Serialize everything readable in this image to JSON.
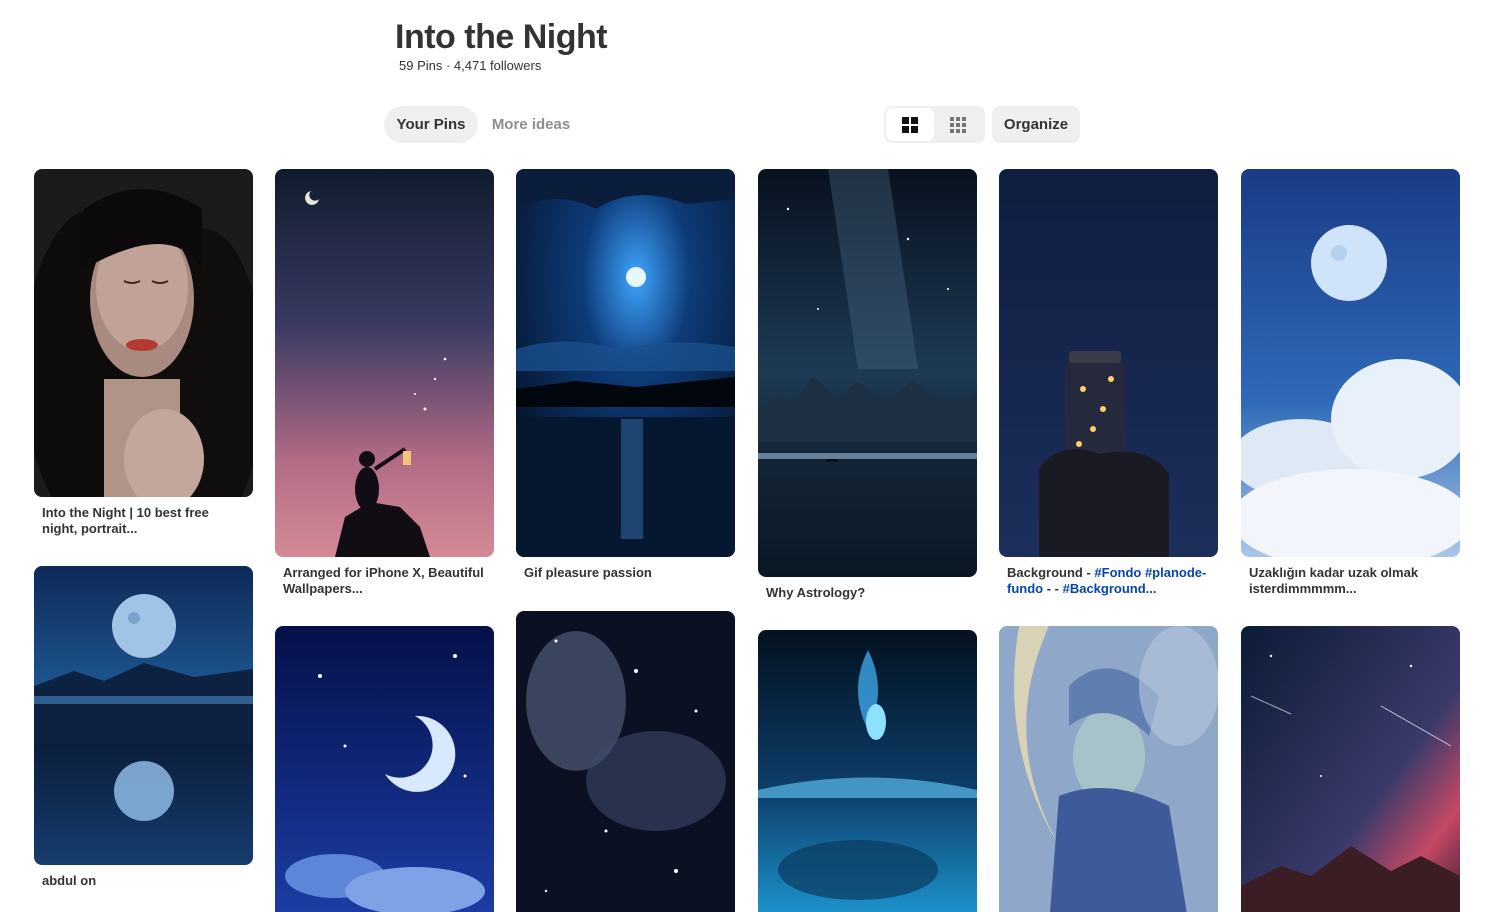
{
  "board": {
    "title": "Into the Night",
    "meta": "59 Pins · 4,471 followers"
  },
  "tabs": {
    "your_pins": "Your Pins",
    "more_ideas": "More ideas"
  },
  "toolbar": {
    "organize_label": "Organize",
    "view_options": [
      "grid-default-icon",
      "grid-compact-icon"
    ]
  },
  "pins": [
    {
      "caption": "Into the Night | 10 best free night, portrait...",
      "icon": "portrait-woman-image"
    },
    {
      "caption": "abdul on",
      "icon": "moon-lake-reflection-image"
    },
    {
      "caption": "Arranged for iPhone X, Beautiful Wallpapers...",
      "icon": "lantern-silhouette-image"
    },
    {
      "caption": "",
      "icon": "crescent-moon-clouds-image"
    },
    {
      "caption": "Gif pleasure passion",
      "icon": "moonlit-sea-image"
    },
    {
      "caption": "",
      "icon": "nebula-stars-image"
    },
    {
      "caption": "Why Astrology?",
      "icon": "milky-way-lake-image"
    },
    {
      "caption": "",
      "icon": "fairy-glow-ocean-image"
    },
    {
      "caption_parts": [
        "Background - ",
        "#Fondo #planode-fundo",
        " - - ",
        "#Background..."
      ],
      "icon": "firefly-jar-image"
    },
    {
      "caption": "",
      "icon": "moon-goddess-painting-image"
    },
    {
      "caption": "Uzaklığın kadar uzak olmak isterdimmmmm...",
      "icon": "full-moon-clouds-image"
    },
    {
      "caption": "",
      "icon": "milky-way-mountains-image"
    }
  ],
  "colors": {
    "tab_active_bg": "#efefef",
    "text_muted": "#8e8e8e",
    "hashtag": "#0645ad"
  }
}
